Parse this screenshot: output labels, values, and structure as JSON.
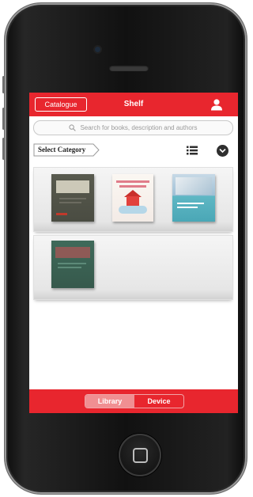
{
  "topbar": {
    "catalogue_label": "Catalogue",
    "title": "Shelf",
    "user_icon": "user-icon"
  },
  "search": {
    "placeholder": "Search for books, description and authors",
    "icon": "search-icon"
  },
  "filters": {
    "category_label": "Select Category",
    "list_view_icon": "list-icon",
    "dropdown_icon": "chevron-down-icon"
  },
  "shelves": [
    {
      "books": [
        "book-cover-1",
        "book-cover-2",
        "book-cover-3"
      ]
    },
    {
      "books": [
        "book-cover-4"
      ]
    }
  ],
  "bottombar": {
    "tabs": [
      {
        "label": "Library",
        "active": true
      },
      {
        "label": "Device",
        "active": false
      }
    ]
  },
  "colors": {
    "accent": "#e8262e",
    "active_tab": "#f08f92"
  }
}
